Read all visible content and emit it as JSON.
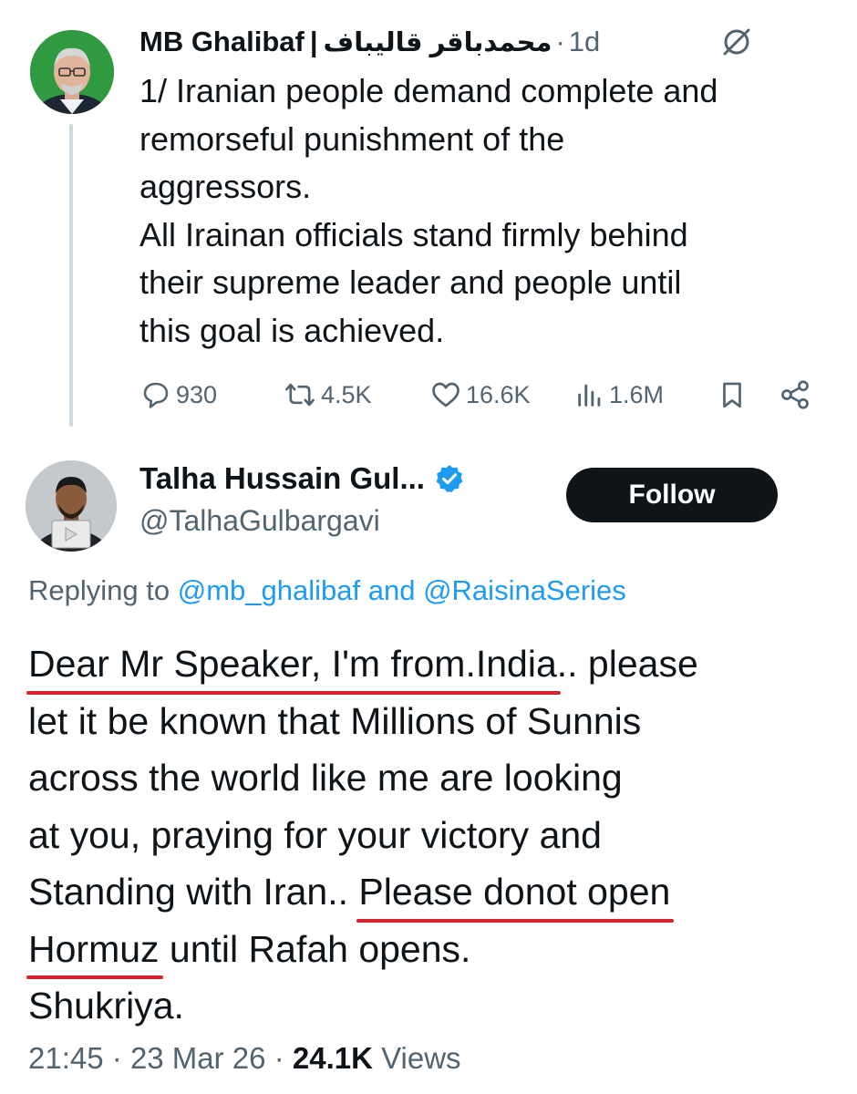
{
  "parent_tweet": {
    "author_name": "MB Ghalibaf",
    "separator": "|",
    "author_name_arabic": "محمدباقر قالیباف",
    "dot": "·",
    "time_ago": "1d",
    "body_lines": [
      "1/ Iranian people demand complete and",
      "remorseful punishment of the",
      "aggressors.",
      "All Irainan officials stand firmly behind",
      "their supreme leader and people until",
      "this goal is achieved."
    ],
    "stats": {
      "replies": "930",
      "reposts": "4.5K",
      "likes": "16.6K",
      "views": "1.6M"
    },
    "icons": {
      "reply": "reply-icon",
      "repost": "repost-icon",
      "like": "heart-icon",
      "views": "views-icon",
      "bookmark": "bookmark-icon",
      "share": "share-icon",
      "grok": "grok-icon"
    }
  },
  "reply_tweet": {
    "author_name": "Talha Hussain Gul...",
    "handle": "@TalhaGulbargavi",
    "verified_color": "#1d9bf0",
    "follow_label": "Follow",
    "replying_prefix": "Replying to",
    "mention_1": "@mb_ghalibaf",
    "replying_and": "and",
    "mention_2": "@RaisinaSeries",
    "body": {
      "l1_ul": "Dear Mr Speaker, I'm from.India",
      "l1_rest": ".. please",
      "l2": "let it be known that Millions of Sunnis",
      "l3": "across the world like me are looking",
      "l4": "at you, praying for your victory and",
      "l5_start": "Standing with Iran.. ",
      "l5_ul": "Please donot open",
      "l6_ul": "Hormuz",
      "l6_rest": " until Rafah opens.",
      "l7": "Shukriya."
    },
    "underline_color": "#d8232f",
    "time": "21:45",
    "dot": "·",
    "date": "23 Mar 26",
    "view_count": "24.1K",
    "views_label": "Views"
  }
}
